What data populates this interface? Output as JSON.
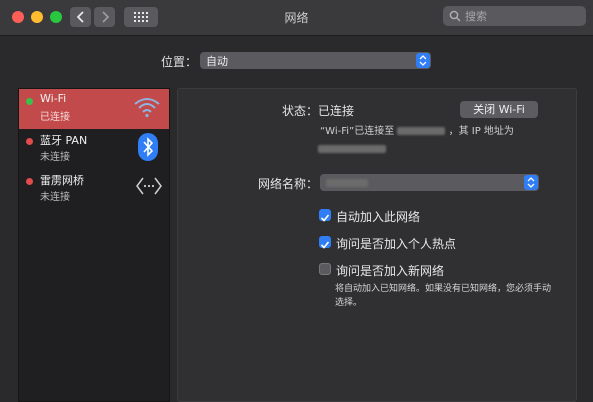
{
  "window": {
    "title": "网络"
  },
  "search": {
    "placeholder": "搜索"
  },
  "location": {
    "label": "位置：",
    "value": "自动"
  },
  "services": [
    {
      "name": "Wi-Fi",
      "status": "已连接",
      "status_color": "#3bc14a"
    },
    {
      "name": "蓝牙 PAN",
      "status": "未连接",
      "status_color": "#e14b4b"
    },
    {
      "name": "雷雳网桥",
      "status": "未连接",
      "status_color": "#e14b4b"
    }
  ],
  "detail": {
    "status_label": "状态：",
    "status_value": "已连接",
    "wifi_off_button": "关闭 Wi-Fi",
    "desc_part1": "“Wi-Fi”已连接至",
    "desc_part2": "，其 IP 地址为",
    "network_name_label": "网络名称：",
    "auto_join_label": "自动加入此网络",
    "hotspot_label": "询问是否加入个人热点",
    "ask_new_label": "询问是否加入新网络",
    "note": "将自动加入已知网络。如果没有已知网络，您必须手动选择。"
  },
  "colors": {
    "selected_row": "#c34a4a",
    "accent": "#2f7ef5"
  }
}
